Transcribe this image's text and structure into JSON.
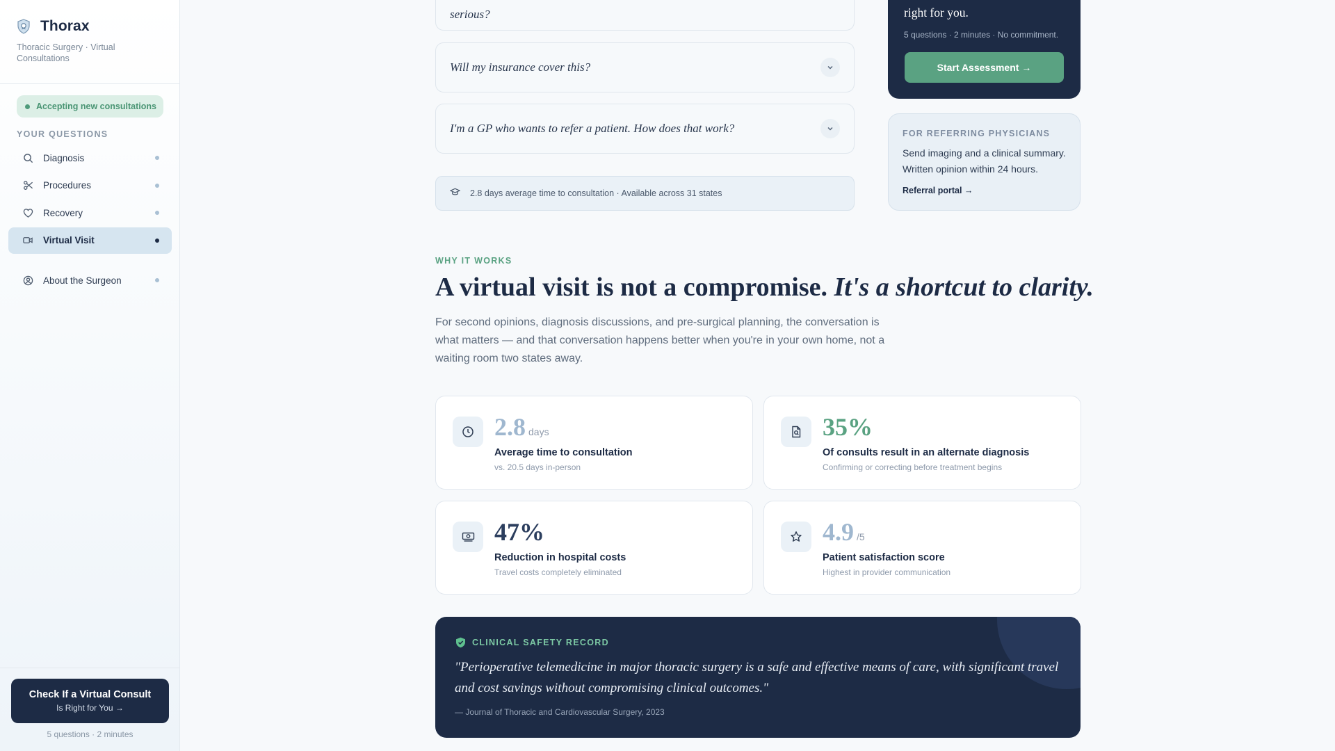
{
  "brand": {
    "name": "Thorax",
    "subtitle": "Thoracic Surgery · Virtual Consultations"
  },
  "sidebar": {
    "status": "Accepting new consultations",
    "section_label": "YOUR QUESTIONS",
    "items": [
      {
        "label": "Diagnosis",
        "icon": "search-icon"
      },
      {
        "label": "Procedures",
        "icon": "scissors-icon"
      },
      {
        "label": "Recovery",
        "icon": "heart-icon"
      },
      {
        "label": "Virtual Visit",
        "icon": "video-icon",
        "active": true
      },
      {
        "label": "About the Surgeon",
        "icon": "user-circle-icon"
      }
    ],
    "cta": {
      "title": "Check If a Virtual Consult",
      "subtitle": "Is Right for You →",
      "meta": "5 questions · 2 minutes"
    }
  },
  "faq": {
    "items": [
      {
        "question": "serious?"
      },
      {
        "question": "Will my insurance cover this?"
      },
      {
        "question": "I'm a GP who wants to refer a patient. How does that work?"
      }
    ],
    "info_bar": "2.8 days average time to consultation · Available across 31 states"
  },
  "assessment": {
    "title": "right for you.",
    "meta": "5 questions · 2 minutes · No commitment.",
    "button": "Start Assessment →"
  },
  "referral": {
    "label": "FOR REFERRING PHYSICIANS",
    "text": "Send imaging and a clinical summary. Written opinion within 24 hours.",
    "link": "Referral portal →"
  },
  "why": {
    "label": "WHY IT WORKS",
    "heading_plain": "A virtual visit is not a compromise. ",
    "heading_italic": "It's a shortcut to clarity.",
    "body": "For second opinions, diagnosis discussions, and pre-surgical planning, the conversation is what matters — and that conversation happens better when you're in your own home, not a waiting room two states away."
  },
  "stats": [
    {
      "value": "2.8",
      "unit": "days",
      "title": "Average time to consultation",
      "sub": "vs. 20.5 days in-person",
      "icon": "clock-icon",
      "color": "#9fb7cf"
    },
    {
      "value": "35%",
      "unit": "",
      "title": "Of consults result in an alternate diagnosis",
      "sub": "Confirming or correcting before treatment begins",
      "icon": "document-search-icon",
      "color": "#5aa282"
    },
    {
      "value": "47%",
      "unit": "",
      "title": "Reduction in hospital costs",
      "sub": "Travel costs completely eliminated",
      "icon": "money-icon",
      "color": "#2c3e5e"
    },
    {
      "value": "4.9",
      "unit": "/5",
      "title": "Patient satisfaction score",
      "sub": "Highest in provider communication",
      "icon": "star-icon",
      "color": "#9fb7cf"
    }
  ],
  "quote": {
    "label": "CLINICAL SAFETY RECORD",
    "text": "\"Perioperative telemedicine in major thoracic surgery is a safe and effective means of care, with significant travel and cost savings without compromising clinical outcomes.\"",
    "cite": "— Journal of Thoracic and Cardiovascular Surgery, 2023"
  },
  "colors": {
    "navy": "#1d2b45",
    "accent_green": "#5aa282",
    "light_blue": "#eaf1f7"
  }
}
